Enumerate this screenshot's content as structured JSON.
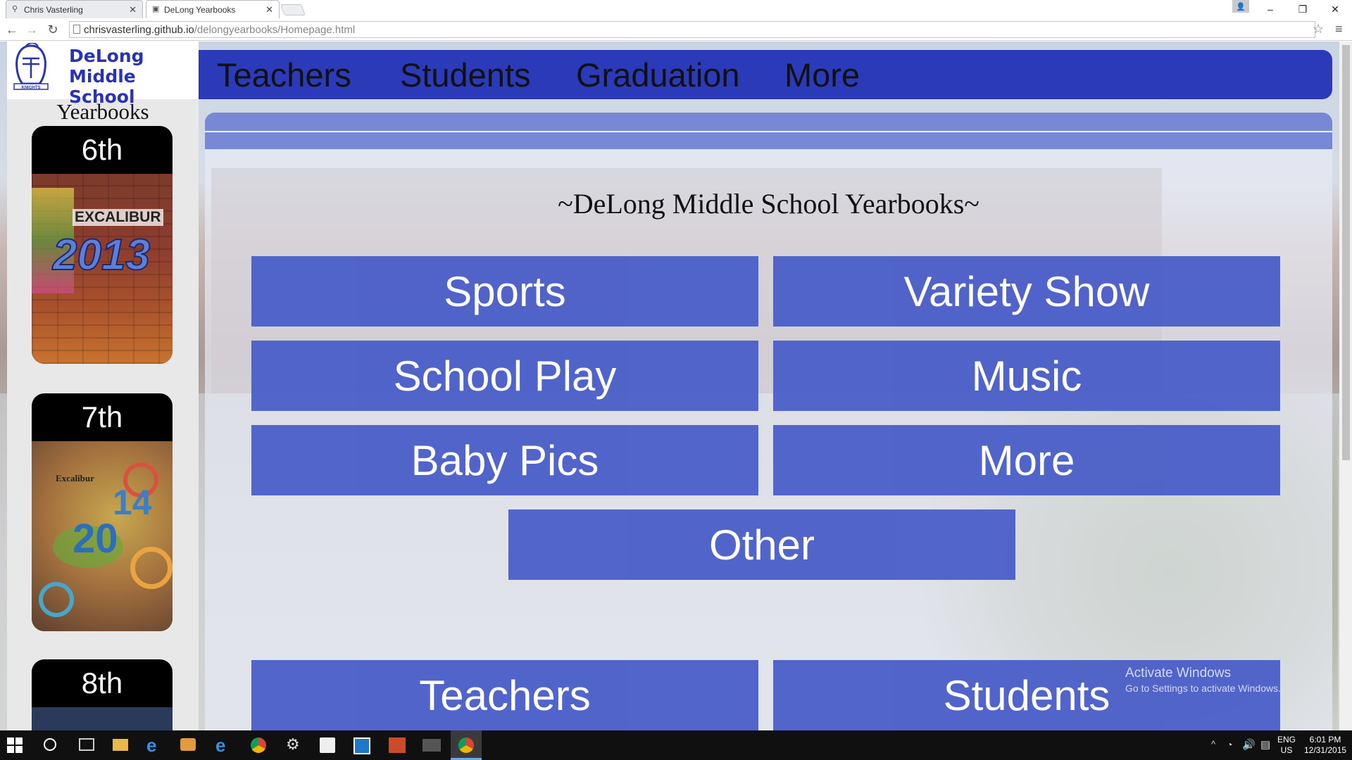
{
  "browser": {
    "tabs": [
      {
        "title": "Chris Vasterling",
        "active": false
      },
      {
        "title": "DeLong Yearbooks",
        "active": true
      }
    ],
    "url_host": "chrisvasterling.github.io",
    "url_path": "/delongyearbooks/Homepage.html",
    "window_controls": [
      "minimize",
      "restore",
      "close"
    ]
  },
  "site": {
    "school_line1": "DeLong",
    "school_line2": "Middle School",
    "yearbooks_label": "Yearbooks",
    "logo_text": "KNIGHTS"
  },
  "sidebar": {
    "grades": [
      {
        "label": "6th",
        "cover_title": "EXCALIBUR",
        "cover_year": "2013"
      },
      {
        "label": "7th",
        "cover_title": "Excalibur",
        "cover_year_top": "14",
        "cover_year_bottom": "20"
      },
      {
        "label": "8th"
      }
    ]
  },
  "topnav": {
    "items": [
      "Teachers",
      "Students",
      "Graduation",
      "More"
    ]
  },
  "main": {
    "heading": "~DeLong Middle School Yearbooks~",
    "categories": [
      "Sports",
      "Variety Show",
      "School Play",
      "Music",
      "Baby Pics",
      "More",
      "Other"
    ],
    "bottom_buttons": [
      "Teachers",
      "Students"
    ]
  },
  "watermark": {
    "line1": "Activate Windows",
    "line2": "Go to Settings to activate Windows."
  },
  "taskbar": {
    "lang1": "ENG",
    "lang2": "US",
    "time": "6:01 PM",
    "date": "12/31/2015"
  },
  "colors": {
    "accent_blue": "#2a3ab8",
    "button_blue": "#4a5ec8",
    "school_text": "#2833b3"
  }
}
